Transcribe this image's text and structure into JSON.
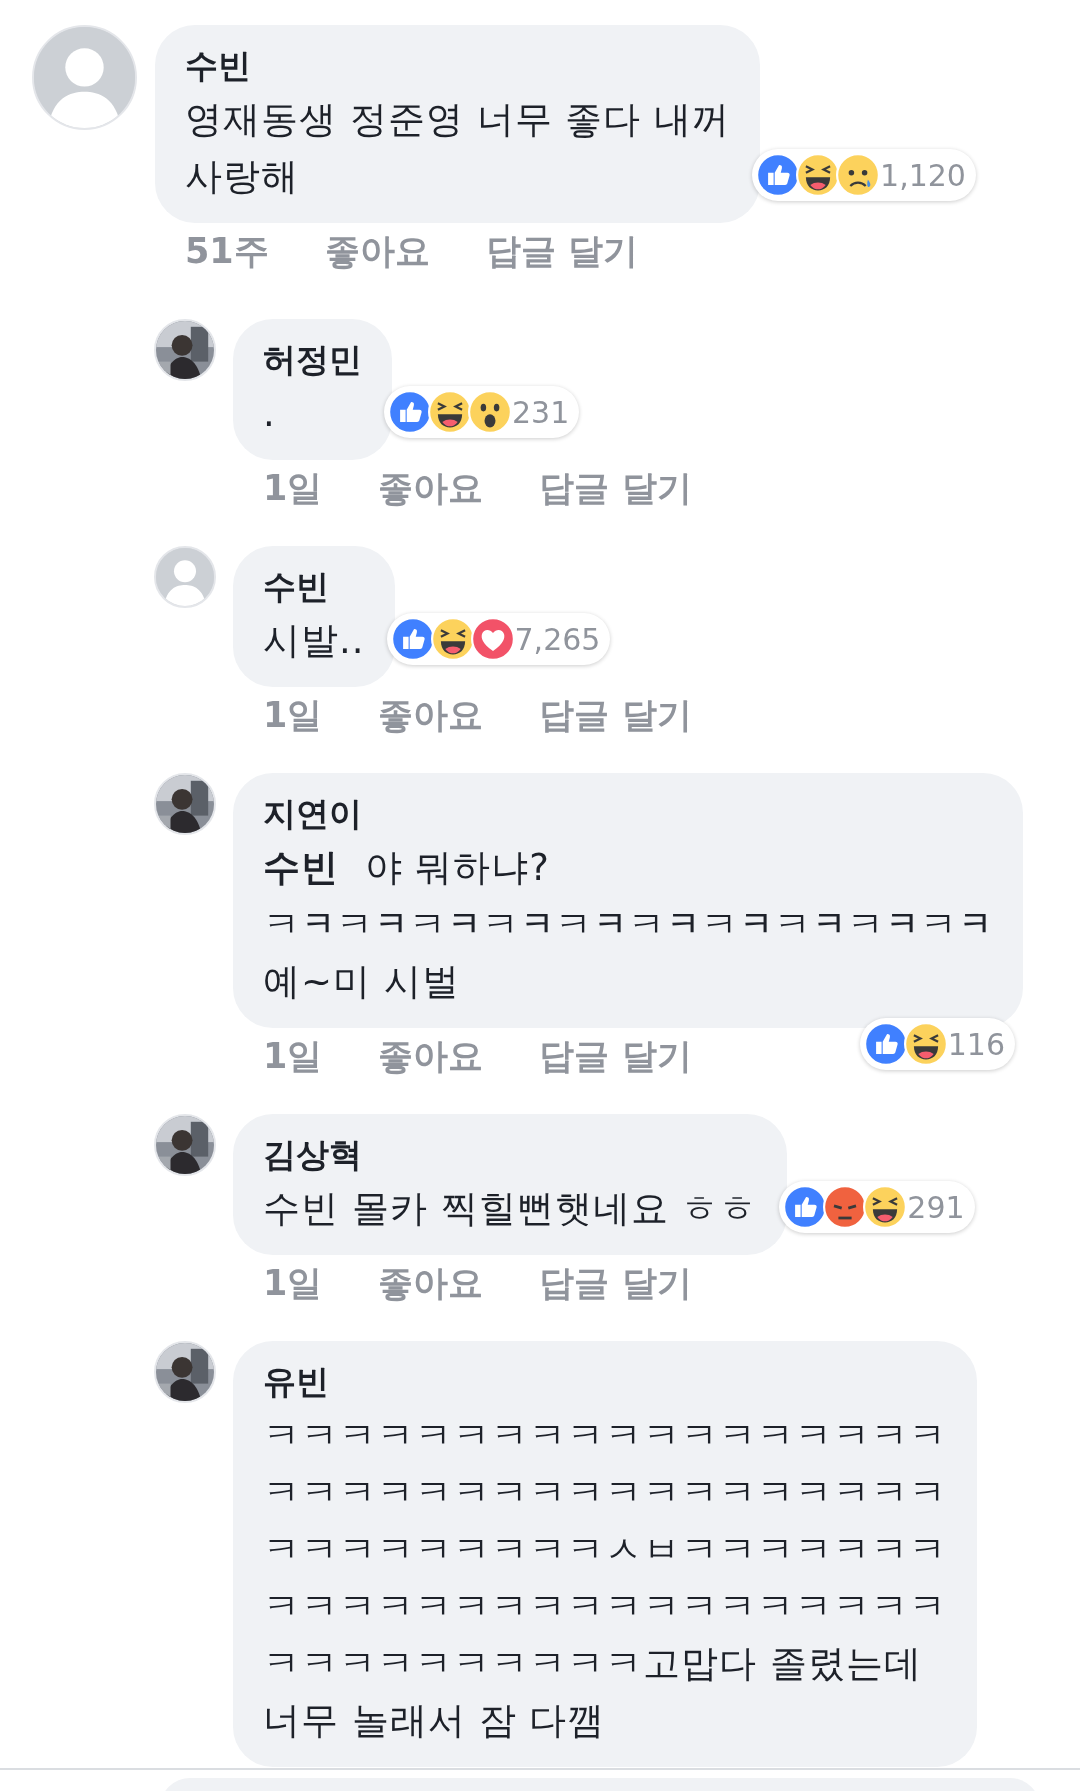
{
  "comments": [
    {
      "avatar": {
        "kind": "default"
      },
      "name": "수빈",
      "lines": [
        "영재동생 정준영 너무 좋다 내꺼",
        "사랑해"
      ],
      "reactions": {
        "kind": "beside",
        "icons": [
          {
            "kind": "like"
          },
          {
            "kind": "haha"
          },
          {
            "kind": "sad"
          }
        ],
        "count": "1,120"
      },
      "time": "51주",
      "like_label": "좋아요",
      "reply_label": "답글 달기",
      "replies": [
        {
          "avatar": {
            "kind": "picture"
          },
          "name": "허정민",
          "lines": [
            "."
          ],
          "reactions": {
            "kind": "beside",
            "icons": [
              {
                "kind": "like"
              },
              {
                "kind": "haha"
              },
              {
                "kind": "wow"
              }
            ],
            "count": "231"
          },
          "time": "1일",
          "like_label": "좋아요",
          "reply_label": "답글 달기"
        },
        {
          "avatar": {
            "kind": "default"
          },
          "name": "수빈",
          "lines": [
            "시발.."
          ],
          "reactions": {
            "kind": "beside",
            "icons": [
              {
                "kind": "like"
              },
              {
                "kind": "haha"
              },
              {
                "kind": "love"
              }
            ],
            "count": "7,265"
          },
          "time": "1일",
          "like_label": "좋아요",
          "reply_label": "답글 달기"
        },
        {
          "avatar": {
            "kind": "picture"
          },
          "name": "지연이",
          "lines": [
            "**수빈**  야 뭐하냐?",
            "ㅋﾻㅋﾻㅋﾻㅋﾻㅋﾻㅋﾻㅋﾻㅋﾻㅋﾻㅋﾻ",
            "예~미 시벌"
          ],
          "reactions": {
            "kind": "under",
            "icons": [
              {
                "kind": "like"
              },
              {
                "kind": "haha"
              }
            ],
            "count": "116"
          },
          "time": "1일",
          "like_label": "좋아요",
          "reply_label": "답글 달기"
        },
        {
          "avatar": {
            "kind": "picture"
          },
          "name": "김상혁",
          "lines": [
            "수빈 몰카 찍힐뻔햇네요 ㅎㅎ"
          ],
          "reactions": {
            "kind": "beside",
            "icons": [
              {
                "kind": "like"
              },
              {
                "kind": "angry"
              },
              {
                "kind": "haha"
              }
            ],
            "count": "291"
          },
          "time": "1일",
          "like_label": "좋아요",
          "reply_label": "답글 달기"
        },
        {
          "avatar": {
            "kind": "picture"
          },
          "name": "유빈",
          "lines": [
            "ㅋㅋㅋㅋㅋㅋㅋㅋㅋㅋㅋㅋㅋㅋㅋㅋㅋㅋ",
            "ㅋㅋㅋㅋㅋㅋㅋㅋㅋㅋㅋㅋㅋㅋㅋㅋㅋㅋ",
            "ㅋㅋㅋㅋㅋㅋㅋㅋㅋㅅㅂㅋㅋㅋㅋㅋㅋㅋ",
            "ㅋㅋㅋㅋㅋㅋㅋㅋㅋㅋㅋㅋㅋㅋㅋㅋㅋㅋ",
            "ㅋㅋㅋㅋㅋㅋㅋㅋㅋㅋ고맙다 졸렸는데",
            "너무 놀래서 잠 다깸"
          ]
        }
      ]
    }
  ]
}
